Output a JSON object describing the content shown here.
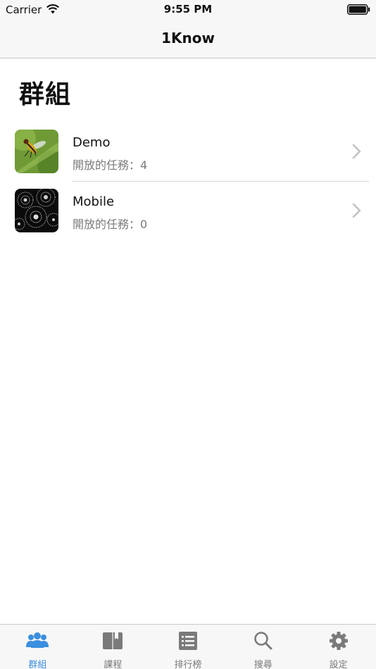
{
  "status_bar": {
    "carrier": "Carrier",
    "time": "9:55 PM"
  },
  "nav": {
    "title": "1Know"
  },
  "page": {
    "title": "群組"
  },
  "groups": [
    {
      "name": "Demo",
      "subtitle": "開放的任務：4",
      "thumbnail": "insect-photo"
    },
    {
      "name": "Mobile",
      "subtitle": "開放的任務：0",
      "thumbnail": "dandelion-photo"
    }
  ],
  "tabs": [
    {
      "label": "群組",
      "icon": "groups-icon",
      "active": true
    },
    {
      "label": "課程",
      "icon": "book-icon",
      "active": false
    },
    {
      "label": "排行榜",
      "icon": "list-icon",
      "active": false
    },
    {
      "label": "搜尋",
      "icon": "search-icon",
      "active": false
    },
    {
      "label": "設定",
      "icon": "gear-icon",
      "active": false
    }
  ],
  "colors": {
    "accent": "#3b8fe0",
    "inactive": "#7a7a7a",
    "bar_bg": "#f7f7f7"
  }
}
